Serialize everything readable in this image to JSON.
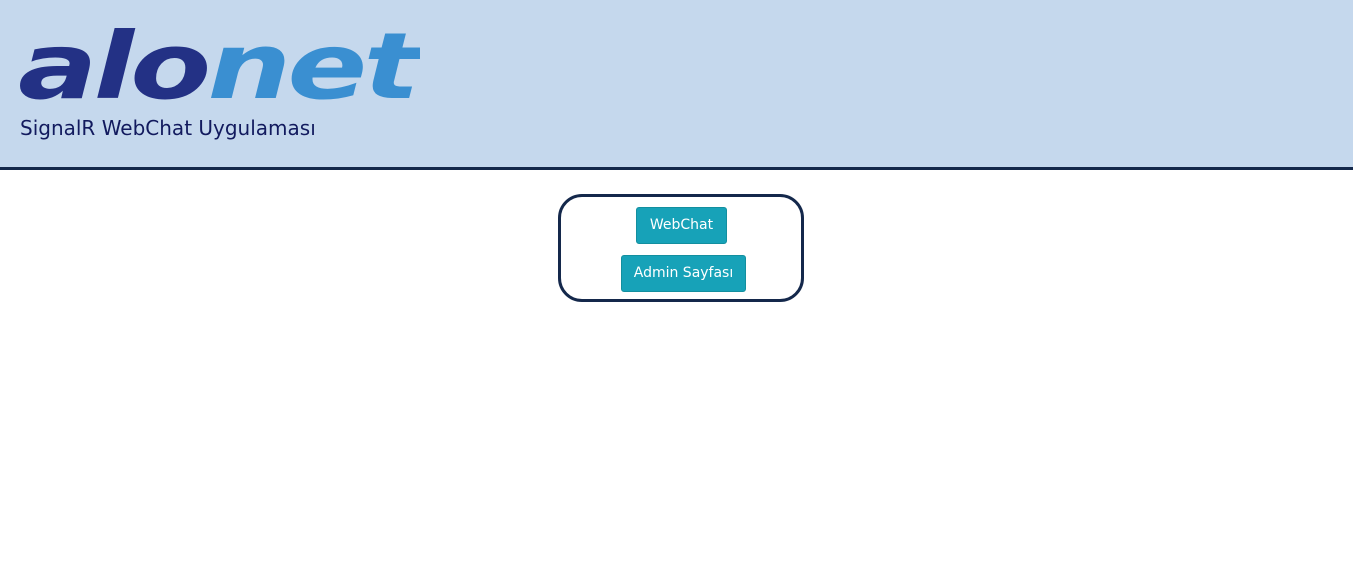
{
  "header": {
    "logo": {
      "part1": "alo",
      "part2": "net",
      "color_dark": "#233185",
      "color_light": "#3a8fd1"
    },
    "subtitle": "SignalR WebChat Uygulaması",
    "background_color": "#c5d8ed"
  },
  "menu": {
    "buttons": [
      {
        "label": "WebChat"
      },
      {
        "label": "Admin Sayfası"
      }
    ],
    "button_color": "#17a2b8",
    "border_color": "#14284b"
  }
}
